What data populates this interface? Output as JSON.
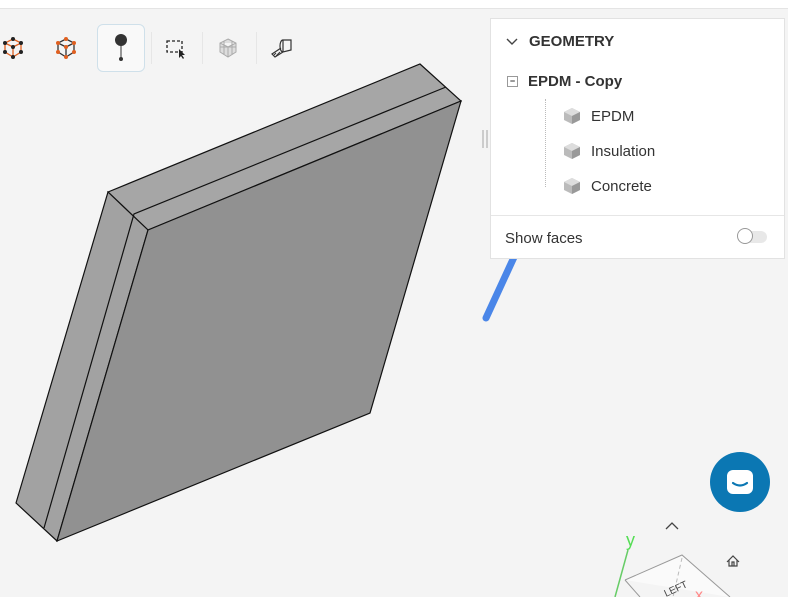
{
  "toolbar": {
    "items": [
      "vertex-select",
      "face-select",
      "point-select",
      "box-select",
      "mesh-view",
      "measure"
    ]
  },
  "panel": {
    "title": "GEOMETRY",
    "root": "EPDM - Copy",
    "children": [
      "EPDM",
      "Insulation",
      "Concrete"
    ],
    "show_faces_label": "Show faces",
    "show_faces": false
  },
  "viewcube": {
    "face_label": "LEFT",
    "axis_y": "y",
    "axis_x": "x"
  },
  "colors": {
    "accent": "#0b77b3",
    "arrow": "#4a86e8"
  }
}
